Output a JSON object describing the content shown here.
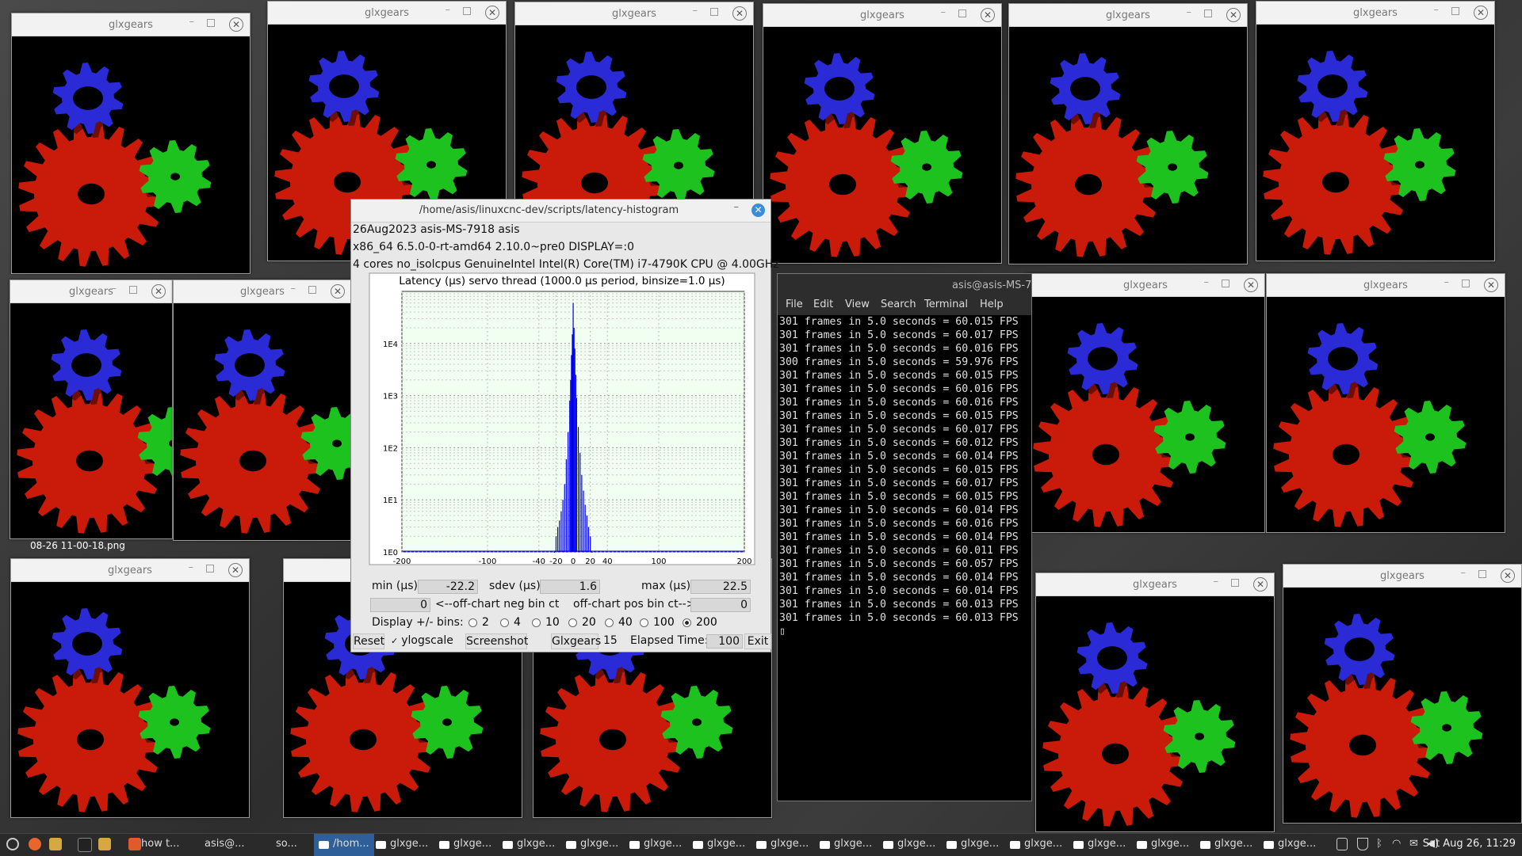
{
  "gear_window_title": "glxgears",
  "gear_windows": [
    {
      "id": "g1"
    },
    {
      "id": "g2"
    },
    {
      "id": "g3"
    },
    {
      "id": "g4"
    },
    {
      "id": "g5"
    },
    {
      "id": "g6"
    },
    {
      "id": "g7"
    },
    {
      "id": "g8"
    },
    {
      "id": "g9"
    },
    {
      "id": "g10"
    },
    {
      "id": "g11"
    },
    {
      "id": "g12"
    },
    {
      "id": "g13"
    },
    {
      "id": "g14"
    },
    {
      "id": "g15"
    }
  ],
  "colors": {
    "gear_red": "#c91a0a",
    "gear_green": "#1ec21e",
    "gear_blue": "#2a2ad6",
    "histogram": "#0000ee",
    "plot_bg": "#f0fff0"
  },
  "desktop_file_label": "08-26 11-00-18.png",
  "latency": {
    "window_title": "/home/asis/linuxcnc-dev/scripts/latency-histogram",
    "info_line1": "26Aug2023 asis-MS-7918 asis",
    "info_line2": "x86_64  6.5.0-0-rt-amd64  2.10.0~pre0  DISPLAY=:0",
    "info_line3": "4 cores  no_isolcpus   GenuineIntel  Intel(R) Core(TM) i7-4790K CPU @ 4.00GHz",
    "min_label": "min (µs)",
    "min_value": "-22.2",
    "sdev_label": "sdev (µs)",
    "sdev_value": "1.6",
    "max_label": "max (µs)",
    "max_value": "22.5",
    "neg_value": "0",
    "neg_label": "<--off-chart neg bin ct",
    "pos_label": "off-chart pos bin ct-->",
    "pos_value": "0",
    "bins_label": "Display +/- bins:",
    "bins": [
      "2",
      "4",
      "10",
      "20",
      "40",
      "100",
      "200"
    ],
    "bins_selected": "200",
    "reset_label": "Reset",
    "ylogscale_label": "ylogscale",
    "ylogscale_checked": true,
    "screenshot_label": "Screenshot",
    "glxgears_label": "Glxgears",
    "glxgears_count": "15",
    "elapsed_label": "Elapsed Time:",
    "elapsed_value": "100",
    "exit_label": "Exit"
  },
  "chart_data": {
    "type": "bar",
    "title": "Latency (µs) servo thread (1000.0 µs period, binsize=1.0 µs)",
    "x_ticks": [
      "-200",
      "-100",
      "-40",
      "-20",
      "0",
      "20",
      "40",
      "100",
      "200"
    ],
    "y_ticks": [
      "1E0",
      "1E1",
      "1E2",
      "1E3",
      "1E4"
    ],
    "xlim": [
      -200,
      200
    ],
    "ylim": [
      1,
      100000
    ],
    "yscale": "log",
    "grid": true,
    "x": [
      -22,
      -20,
      -18,
      -16,
      -14,
      -12,
      -10,
      -8,
      -6,
      -4,
      -3,
      -2,
      -1,
      0,
      1,
      2,
      3,
      4,
      6,
      8,
      10,
      12,
      14,
      16,
      18,
      20,
      22
    ],
    "values": [
      1,
      2,
      3,
      4,
      6,
      10,
      20,
      60,
      200,
      800,
      2000,
      6000,
      15000,
      60000,
      20000,
      8000,
      2500,
      900,
      250,
      80,
      30,
      15,
      8,
      5,
      3,
      2,
      1
    ]
  },
  "terminal": {
    "title": "asis@asis-MS-7",
    "menu": [
      "File",
      "Edit",
      "View",
      "Search",
      "Terminal",
      "Help"
    ],
    "lines": [
      "301 frames in 5.0 seconds = 60.015 FPS",
      "301 frames in 5.0 seconds = 60.017 FPS",
      "301 frames in 5.0 seconds = 60.016 FPS",
      "300 frames in 5.0 seconds = 59.976 FPS",
      "301 frames in 5.0 seconds = 60.015 FPS",
      "301 frames in 5.0 seconds = 60.016 FPS",
      "301 frames in 5.0 seconds = 60.016 FPS",
      "301 frames in 5.0 seconds = 60.015 FPS",
      "301 frames in 5.0 seconds = 60.017 FPS",
      "301 frames in 5.0 seconds = 60.012 FPS",
      "301 frames in 5.0 seconds = 60.014 FPS",
      "301 frames in 5.0 seconds = 60.015 FPS",
      "301 frames in 5.0 seconds = 60.017 FPS",
      "301 frames in 5.0 seconds = 60.015 FPS",
      "301 frames in 5.0 seconds = 60.014 FPS",
      "301 frames in 5.0 seconds = 60.016 FPS",
      "301 frames in 5.0 seconds = 60.014 FPS",
      "301 frames in 5.0 seconds = 60.011 FPS",
      "301 frames in 5.0 seconds = 60.057 FPS",
      "301 frames in 5.0 seconds = 60.014 FPS",
      "301 frames in 5.0 seconds = 60.014 FPS",
      "301 frames in 5.0 seconds = 60.013 FPS",
      "301 frames in 5.0 seconds = 60.013 FPS"
    ]
  },
  "taskbar": {
    "items": [
      "how t...",
      "asis@...",
      "so...",
      "/hom...",
      "glxge...",
      "glxge...",
      "glxge...",
      "glxge...",
      "glxge...",
      "glxge...",
      "glxge...",
      "glxge...",
      "glxge...",
      "glxge...",
      "glxge...",
      "glxge...",
      "glxge...",
      "glxge...",
      "glxge..."
    ],
    "clock": "Sat Aug 26, 11:29"
  }
}
